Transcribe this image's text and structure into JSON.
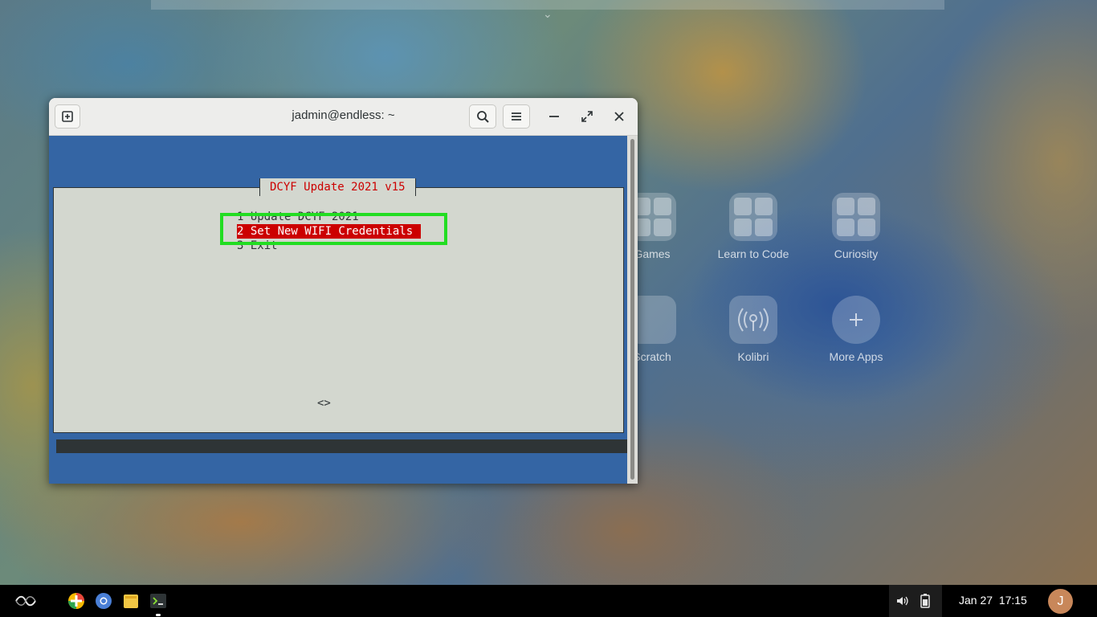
{
  "window": {
    "title": "jadmin@endless: ~"
  },
  "dialog": {
    "title": "DCYF Update 2021 v15",
    "menu_items": [
      {
        "label": "1 Update DCYF 2021"
      },
      {
        "label": "2 Set New WIFI Credentials",
        "selected": true
      },
      {
        "label": "3 Exit"
      }
    ],
    "buttons": "<>"
  },
  "apps": [
    {
      "label": "Games",
      "icon": "games-folder-icon"
    },
    {
      "label": "Learn to Code",
      "icon": "learn-to-code-folder-icon"
    },
    {
      "label": "Curiosity",
      "icon": "curiosity-folder-icon"
    },
    {
      "label": "Scratch",
      "icon": "scratch-icon"
    },
    {
      "label": "Kolibri",
      "icon": "kolibri-icon"
    },
    {
      "label": "More Apps",
      "icon": "add-app-icon"
    }
  ],
  "taskbar": {
    "clock": "Jan 27  17:15",
    "avatar_initial": "J",
    "launchers": [
      "endless-menu-icon",
      "app-center-icon",
      "chromium-icon",
      "files-icon",
      "terminal-icon"
    ]
  },
  "colors": {
    "terminal_bg": "#3465a4",
    "dialog_bg": "#d3d7cf",
    "selected_bg": "#cc0000",
    "highlight_box": "#22dd22"
  }
}
